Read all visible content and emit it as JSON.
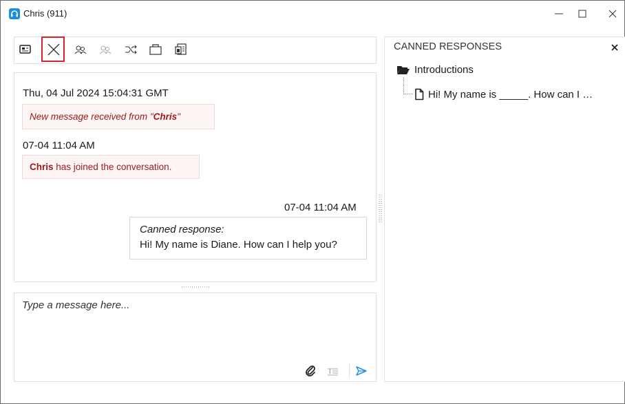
{
  "window": {
    "title": "Chris (911)",
    "controls": {
      "minimize": "minimize-icon",
      "maximize": "maximize-icon",
      "close": "close-icon"
    }
  },
  "toolbar": {
    "icons": [
      "contact-card-icon",
      "end-conversation-icon",
      "transfer-agent-icon",
      "conference-icon",
      "transfer-queue-icon",
      "folder-icon",
      "reports-icon"
    ]
  },
  "chat": {
    "entries": [
      {
        "timestamp": "Thu, 04 Jul 2024 15:04:31 GMT",
        "message_prefix": "New message received from \"",
        "message_name": "Chris",
        "message_suffix": "\""
      },
      {
        "timestamp": "07-04 11:04 AM",
        "message_name": "Chris",
        "message_suffix": " has joined the conversation."
      },
      {
        "timestamp": "07-04 11:04 AM",
        "label": "Canned response:",
        "text": "Hi! My name is Diane. How can I help you?"
      }
    ]
  },
  "input": {
    "placeholder": "Type a message here...",
    "value": ""
  },
  "canned": {
    "title": "CANNED RESPONSES",
    "folder": "Introductions",
    "item": "Hi! My name is _____. How can I …"
  },
  "colors": {
    "accent": "#1e90d8",
    "system_text": "#9b1b1b",
    "system_bg": "#fdf4f4",
    "highlight_border": "#e0202a",
    "send": "#2b8fe0"
  }
}
